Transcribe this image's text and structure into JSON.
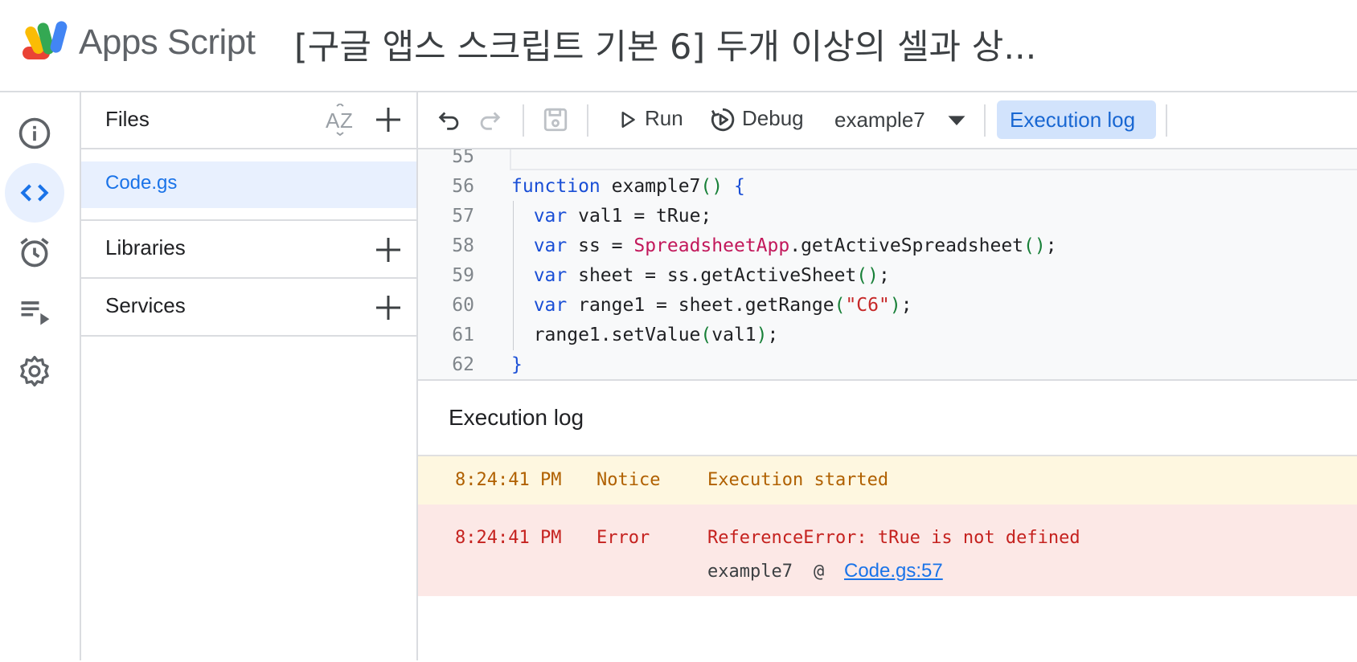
{
  "header": {
    "app_name": "Apps Script",
    "project_title": "[구글 앱스 스크립트 기본 6] 두개 이상의 셀과 상..."
  },
  "rail": {
    "items": [
      "info-icon",
      "code-icon",
      "alarm-icon",
      "executions-icon",
      "settings-icon"
    ],
    "active": "code-icon"
  },
  "files_panel": {
    "title": "Files",
    "files": [
      "Code.gs"
    ],
    "libraries_label": "Libraries",
    "services_label": "Services"
  },
  "toolbar": {
    "run_label": "Run",
    "debug_label": "Debug",
    "function_select": "example7",
    "execution_log_label": "Execution log"
  },
  "editor": {
    "line_numbers": [
      "55",
      "56",
      "57",
      "58",
      "59",
      "60",
      "61",
      "62"
    ],
    "lines": [
      "",
      "function example7() {",
      "  var val1 = tRue;",
      "  var ss = SpreadsheetApp.getActiveSpreadsheet();",
      "  var sheet = ss.getActiveSheet();",
      "  var range1 = sheet.getRange(\"C6\");",
      "  range1.setValue(val1);",
      "}"
    ]
  },
  "execution_log": {
    "title": "Execution log",
    "entries": [
      {
        "time": "8:24:41 PM",
        "level": "Notice",
        "message": "Execution started"
      },
      {
        "time": "8:24:41 PM",
        "level": "Error",
        "message": "ReferenceError: tRue is not defined",
        "trace_fn": "example7",
        "trace_at": "@",
        "trace_link": "Code.gs:57"
      }
    ]
  },
  "colors": {
    "accent": "#1a73e8",
    "notice_bg": "#fef7e0",
    "error_bg": "#fce8e6",
    "error_text": "#c5221f"
  }
}
